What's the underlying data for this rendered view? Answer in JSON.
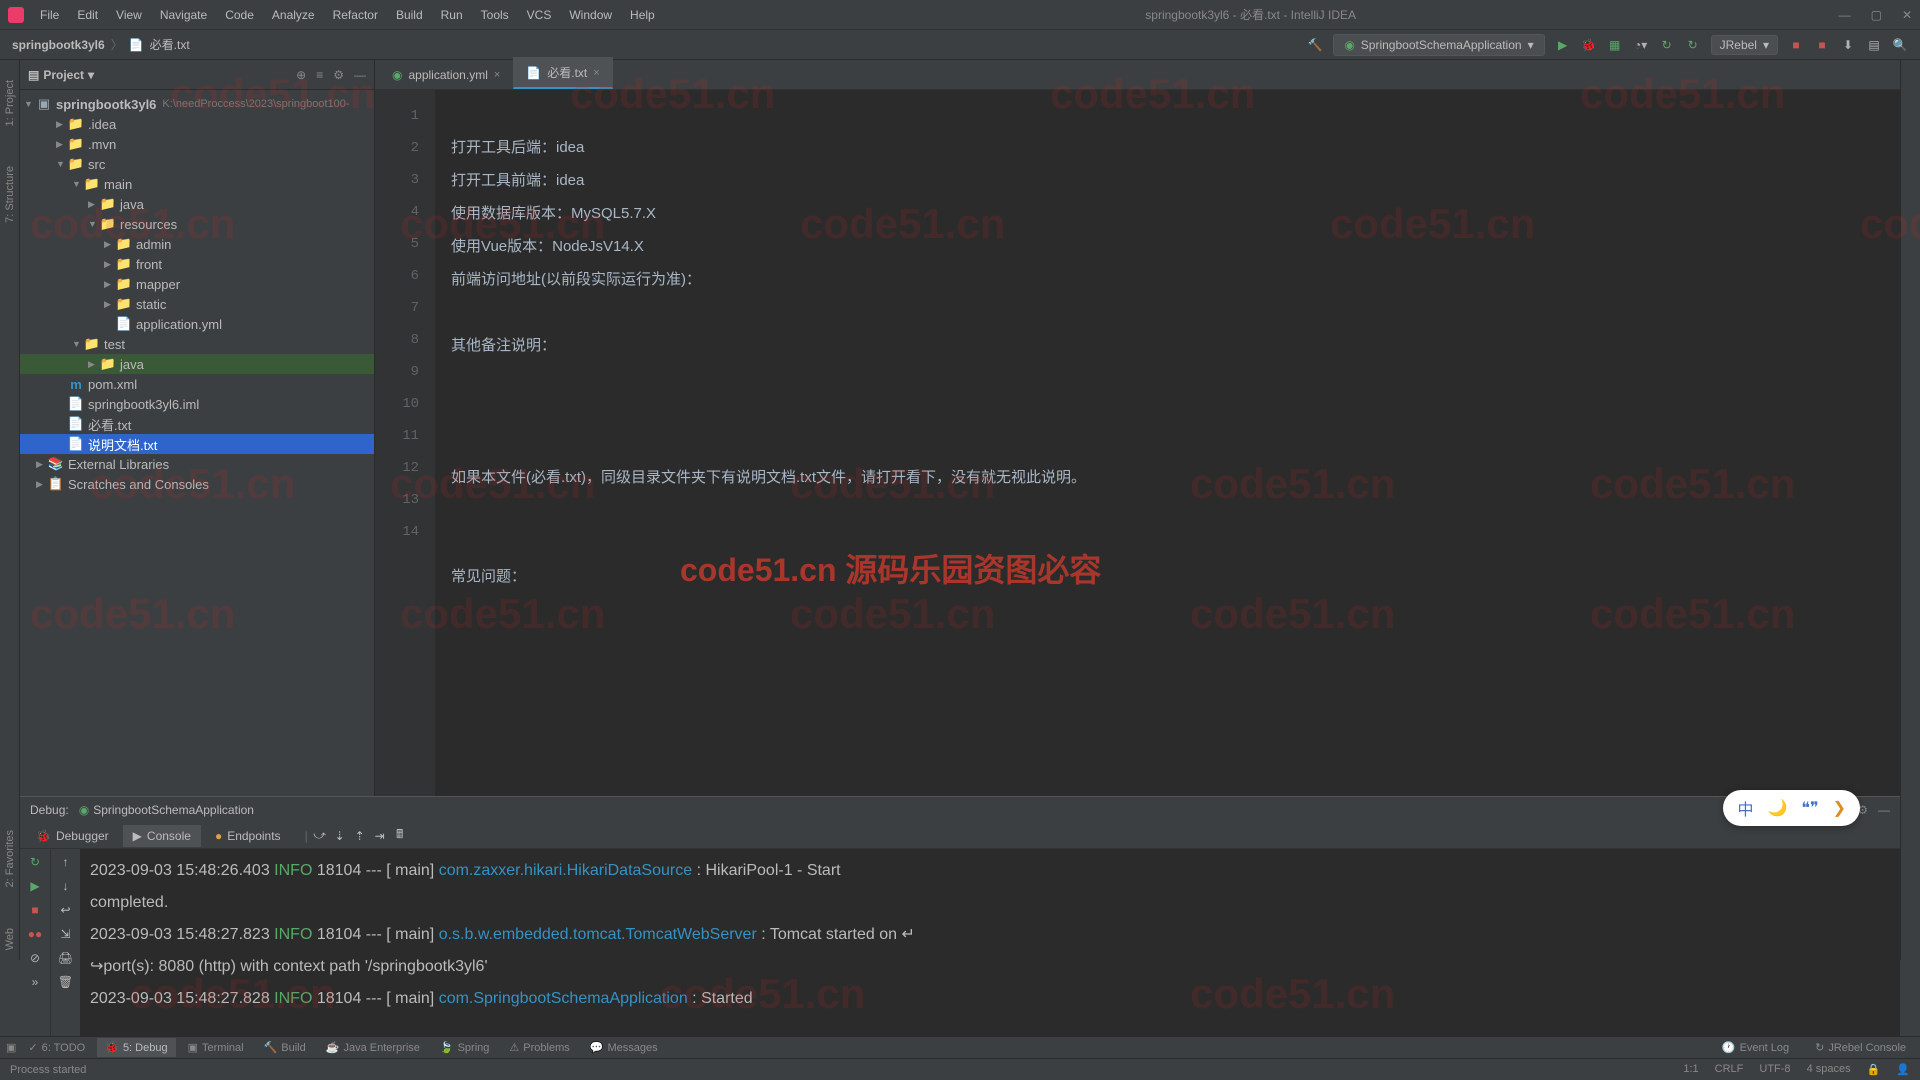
{
  "window": {
    "title": "springbootk3yl6 - 必看.txt - IntelliJ IDEA"
  },
  "menu": [
    "File",
    "Edit",
    "View",
    "Navigate",
    "Code",
    "Analyze",
    "Refactor",
    "Build",
    "Run",
    "Tools",
    "VCS",
    "Window",
    "Help"
  ],
  "breadcrumb": {
    "project": "springbootk3yl6",
    "file": "必看.txt"
  },
  "run_config": "SpringbootSchemaApplication",
  "jrebel": "JRebel",
  "project_panel": {
    "title": "Project",
    "root": {
      "name": "springbootk3yl6",
      "path": "K:\\needProccess\\2023\\springboot100-"
    },
    "items": {
      "idea": ".idea",
      "mvn": ".mvn",
      "src": "src",
      "main": "main",
      "java_main": "java",
      "resources": "resources",
      "admin": "admin",
      "front": "front",
      "mapper": "mapper",
      "static": "static",
      "appyml": "application.yml",
      "test": "test",
      "java_test": "java",
      "pom": "pom.xml",
      "iml": "springbootk3yl6.iml",
      "bikan": "必看.txt",
      "shuoming": "说明文档.txt",
      "extlib": "External Libraries",
      "scratches": "Scratches and Consoles"
    }
  },
  "tabs": {
    "t1": "application.yml",
    "t2": "必看.txt"
  },
  "editor": {
    "lines": {
      "l1": "打开工具后端：idea",
      "l2": "打开工具前端：idea",
      "l3": "使用数据库版本：MySQL5.7.X",
      "l4": "使用Vue版本：NodeJsV14.X",
      "l5": "前端访问地址(以前段实际运行为准)：",
      "l6": "",
      "l7": "其他备注说明：",
      "l8": "",
      "l9": "",
      "l10": "",
      "l11": "如果本文件(必看.txt)，同级目录文件夹下有说明文档.txt文件，请打开看下，没有就无视此说明。",
      "l12": "",
      "l13": "",
      "l14": "常见问题："
    }
  },
  "debug": {
    "label": "Debug:",
    "app": "SpringbootSchemaApplication",
    "tabs": {
      "debugger": "Debugger",
      "console": "Console",
      "endpoints": "Endpoints"
    },
    "console_lines": {
      "c1_ts": "2023-09-03 15:48:26.403",
      "c1_level": "INFO",
      "c1_pid": "18104",
      "c1_thread": "main]",
      "c1_class": "com.zaxxer.hikari.HikariDataSource",
      "c1_msg": ": HikariPool-1 - Start",
      "c1_cont": "completed.",
      "c2_ts": "2023-09-03 15:48:27.823",
      "c2_level": "INFO",
      "c2_pid": "18104",
      "c2_thread": "main]",
      "c2_class": "o.s.b.w.embedded.tomcat.TomcatWebServer",
      "c2_msg": ": Tomcat started on ",
      "c2_cont": "port(s): 8080 (http) with context path '/springbootk3yl6'",
      "c3_ts": "2023-09-03 15:48:27.828",
      "c3_level": "INFO",
      "c3_pid": "18104",
      "c3_thread": "main]",
      "c3_class": "com.SpringbootSchemaApplication",
      "c3_msg": ": Started"
    }
  },
  "bottom_tools": {
    "todo": "6: TODO",
    "debug": "5: Debug",
    "terminal": "Terminal",
    "build": "Build",
    "jee": "Java Enterprise",
    "spring": "Spring",
    "problems": "Problems",
    "messages": "Messages",
    "eventlog": "Event Log",
    "jrebelcon": "JRebel Console"
  },
  "status": {
    "left": "Process started",
    "pos": "1:1",
    "crlf": "CRLF",
    "enc": "UTF-8",
    "indent": "4 spaces"
  },
  "left_strip": {
    "project": "1: Project",
    "structure": "7: Structure",
    "favorites": "2: Favorites",
    "web": "Web"
  },
  "watermark": "code51.cn",
  "watermark_center": "code51.cn 源码乐园资图必容",
  "ime": {
    "zhong": "中",
    "moon": "🌙",
    "quote": "❝❞",
    "arrow": "❯"
  }
}
